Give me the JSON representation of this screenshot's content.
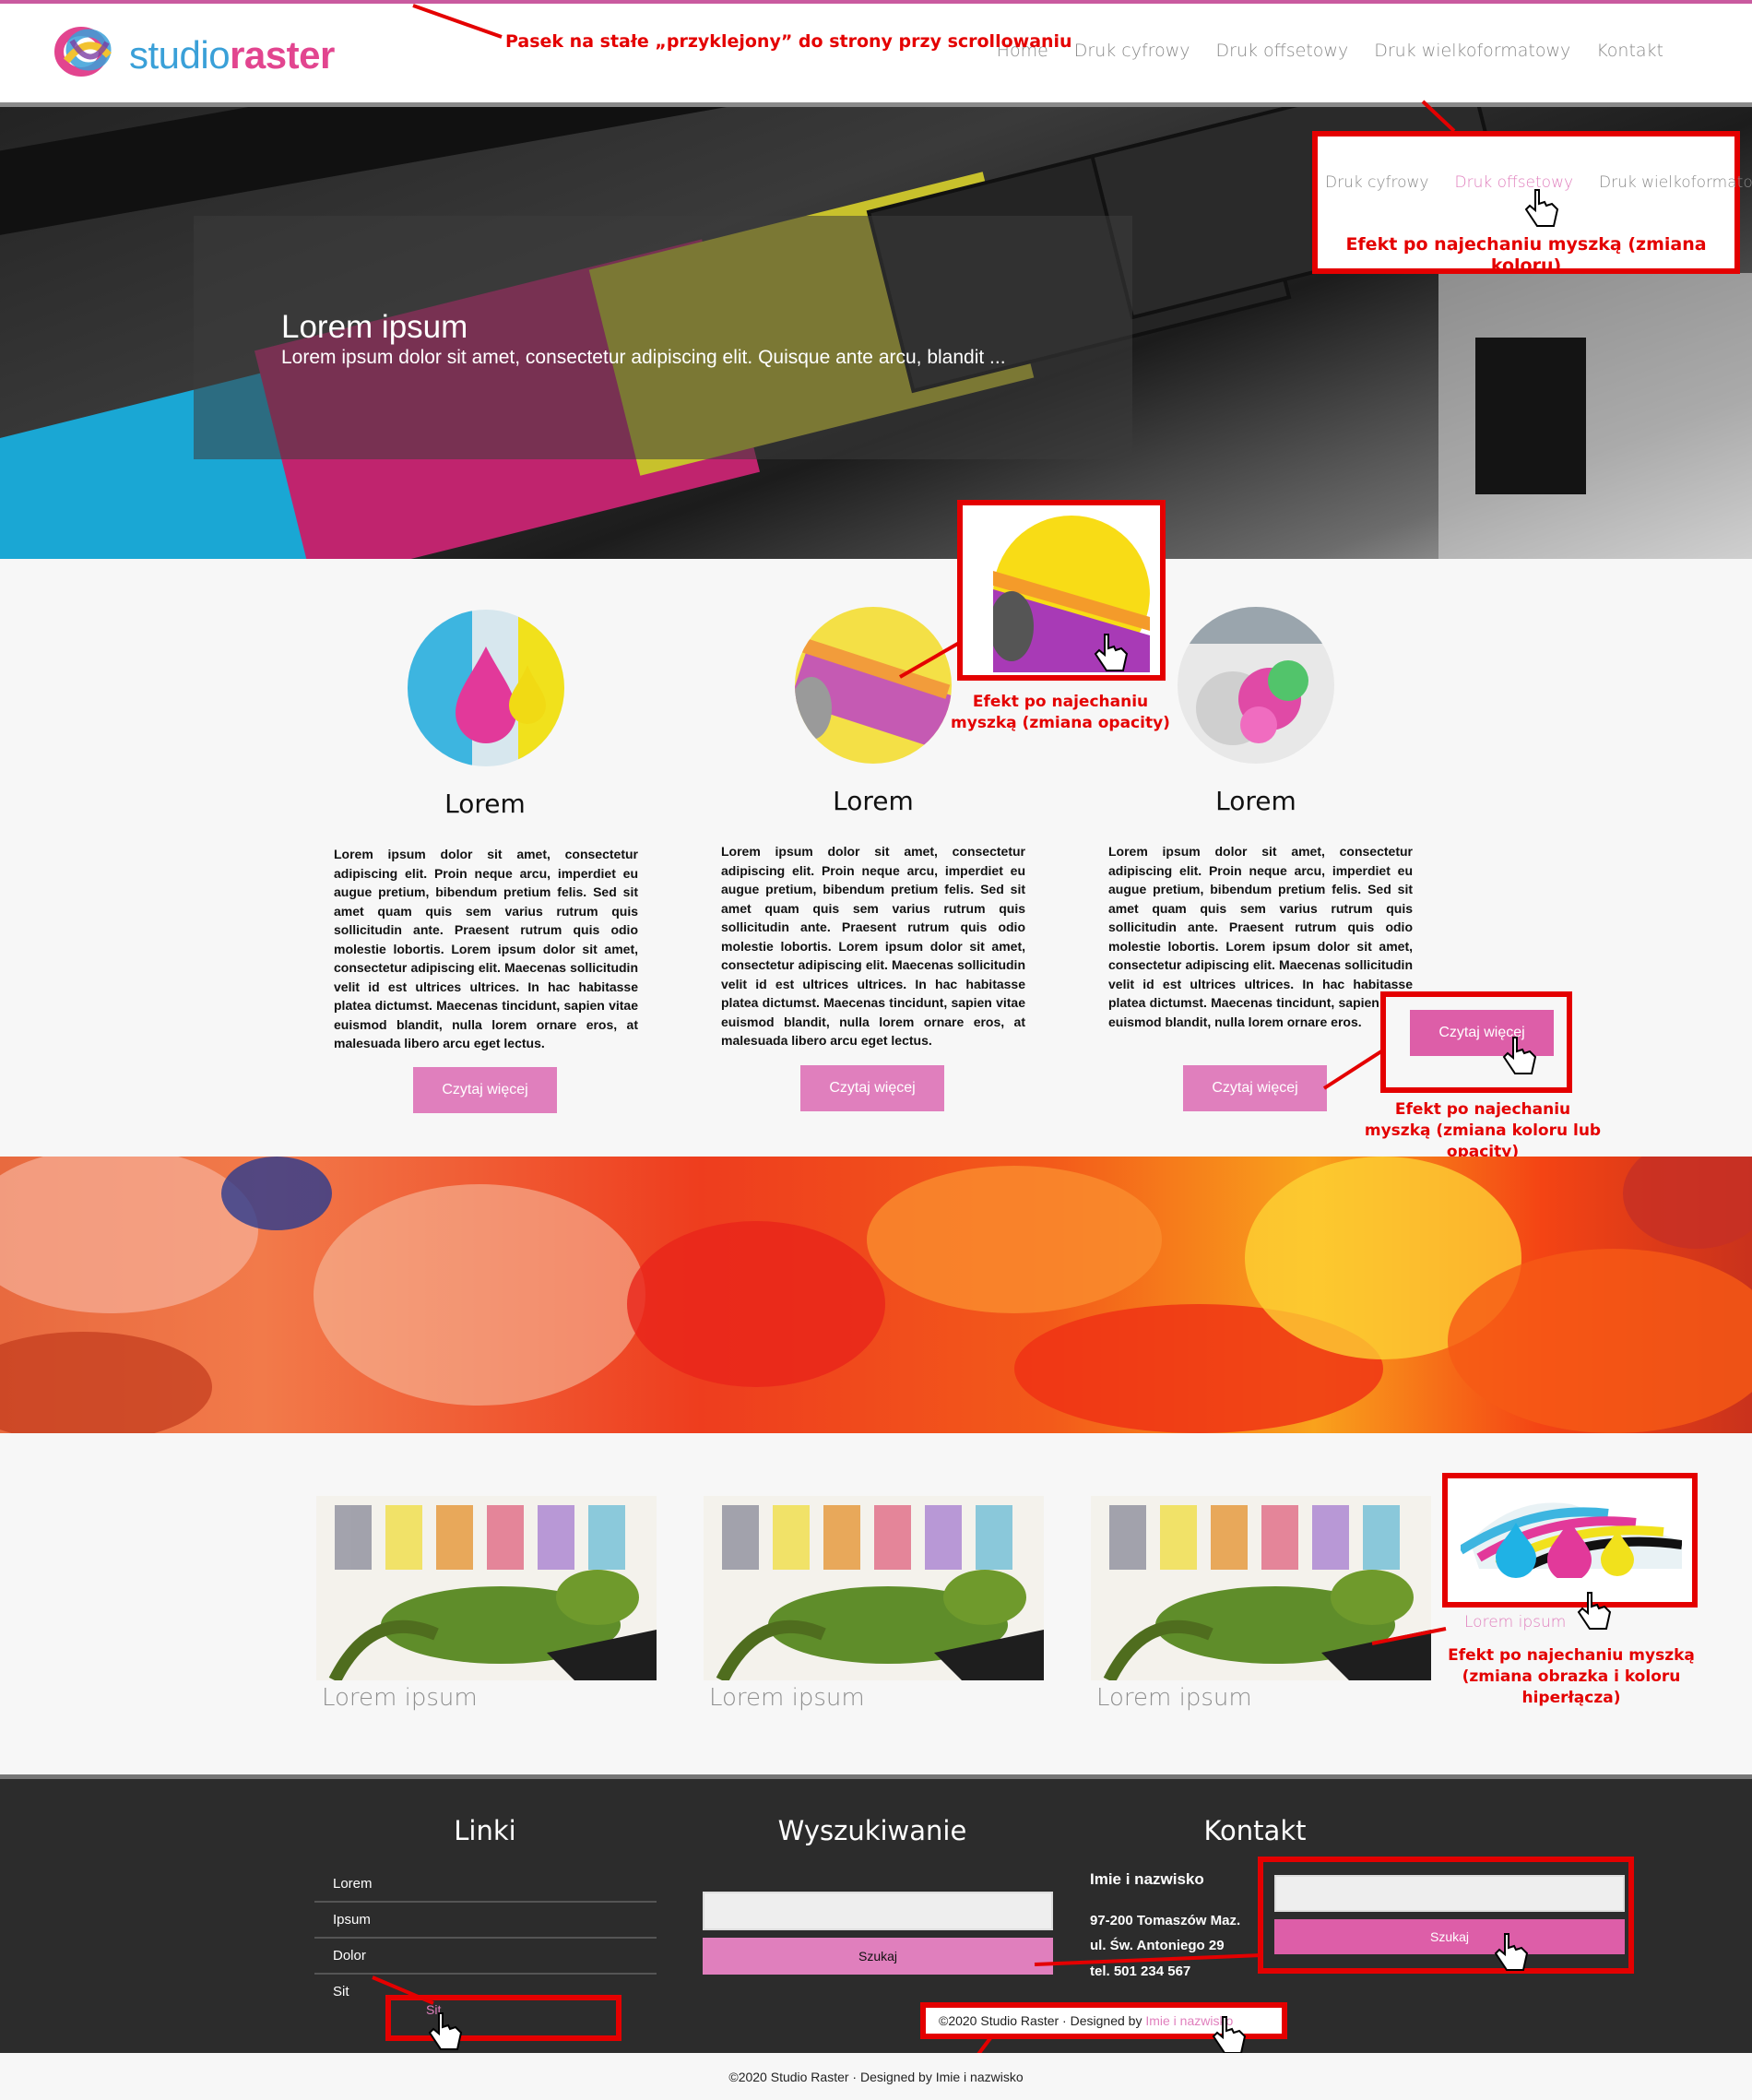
{
  "colors": {
    "accent": "#e07fbd",
    "brand_pink": "#e2458f",
    "brand_blue": "#3aa0d8",
    "annotation_red": "#e40000",
    "footer_bg": "#2c2c2c"
  },
  "logo": {
    "part1": "studio",
    "part2": "raster"
  },
  "nav": [
    "Home",
    "Druk cyfrowy",
    "Druk offsetowy",
    "Druk wielkoformatowy",
    "Kontakt"
  ],
  "hero": {
    "title": "Lorem ipsum",
    "subtitle": "Lorem ipsum dolor sit amet, consectetur adipiscing elit. Quisque ante arcu, blandit ..."
  },
  "annotations": {
    "sticky": "Pasek na stałe „przyklejony” do strony przy scrollowaniu",
    "nav_hover": "Efekt po najechaniu myszką (zmiana koloru)",
    "nav_hover_items": [
      "Druk cyfrowy",
      "Druk offsetowy",
      "Druk wielkoformatowy"
    ],
    "opacity": "Efekt po najechaniu myszką (zmiana opacity)",
    "button": "Efekt po najechaniu myszką (zmiana koloru lub opacity)",
    "button_label": "Czytaj więcej",
    "image_link": "Efekt po najechaniu myszką (zmiana obrazka i koloru hiperłącza)",
    "image_link_label": "Lorem ipsum",
    "footer_link": "Sit",
    "search_button": "Szukaj",
    "designed": "©2020 Studio Raster · Designed by",
    "designed_name": "Imie i nazwisko"
  },
  "features": [
    {
      "title": "Lorem",
      "button": "Czytaj więcej",
      "body": "Lorem ipsum dolor sit amet, consectetur adipiscing elit. Proin neque arcu, imperdiet eu augue pretium, bibendum pretium felis. Sed sit amet quam quis sem varius rutrum quis sollicitudin ante. Praesent rutrum quis odio molestie lobortis. Lorem ipsum dolor sit amet, consectetur adipiscing elit. Maecenas sollicitudin velit id est ultrices ultrices. In hac habitasse platea dictumst. Maecenas tincidunt, sapien vitae euismod blandit, nulla lorem ornare eros, at malesuada libero arcu eget lectus."
    },
    {
      "title": "Lorem",
      "button": "Czytaj więcej",
      "body": "Lorem ipsum dolor sit amet, consectetur adipiscing elit. Proin neque arcu, imperdiet eu augue pretium, bibendum pretium felis. Sed sit amet quam quis sem varius rutrum quis sollicitudin ante. Praesent rutrum quis odio molestie lobortis. Lorem ipsum dolor sit amet, consectetur adipiscing elit. Maecenas sollicitudin velit id est ultrices ultrices. In hac habitasse platea dictumst. Maecenas tincidunt, sapien vitae euismod blandit, nulla lorem ornare eros, at malesuada libero arcu eget lectus."
    },
    {
      "title": "Lorem",
      "button": "Czytaj więcej",
      "body": "Lorem ipsum dolor sit amet, consectetur adipiscing elit. Proin neque arcu, imperdiet eu augue pretium, bibendum pretium felis. Sed sit amet quam quis sem varius rutrum quis sollicitudin ante. Praesent rutrum quis odio molestie lobortis. Lorem ipsum dolor sit amet, consectetur adipiscing elit. Maecenas sollicitudin velit id est ultrices ultrices. In hac habitasse platea dictumst. Maecenas tincidunt, sapien vitae euismod blandit, nulla lorem ornare eros."
    }
  ],
  "gallery": [
    "Lorem ipsum",
    "Lorem ipsum",
    "Lorem ipsum"
  ],
  "footer": {
    "links_title": "Linki",
    "links": [
      "Lorem",
      "Ipsum",
      "Dolor",
      "Sit"
    ],
    "search_title": "Wyszukiwanie",
    "search_button": "Szukaj",
    "contact_title": "Kontakt",
    "contact_name": "Imie i nazwisko",
    "contact_address1": "97-200 Tomaszów Maz.",
    "contact_address2": "ul. Św. Antoniego 29",
    "contact_phone": "tel. 501 234 567"
  },
  "copyright": "©2020 Studio Raster · Designed by Imie i nazwisko"
}
